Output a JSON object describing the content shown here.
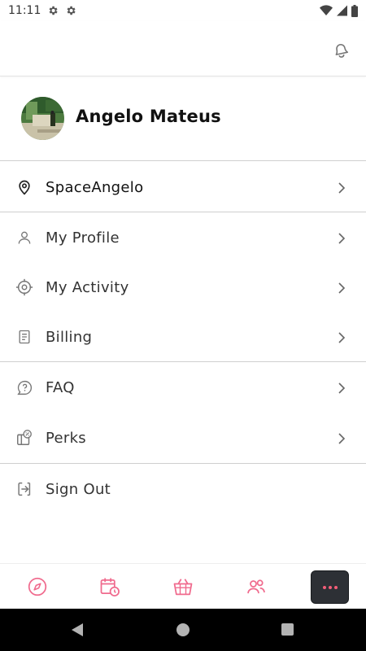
{
  "status_bar": {
    "time": "11:11"
  },
  "profile": {
    "name": "Angelo Mateus"
  },
  "menu": {
    "location": "SpaceAngelo",
    "my_profile": "My Profile",
    "my_activity": "My Activity",
    "billing": "Billing",
    "faq": "FAQ",
    "perks": "Perks",
    "sign_out": "Sign Out"
  },
  "bottom_nav": {
    "items": [
      "compass-icon",
      "calendar-clock-icon",
      "basket-icon",
      "people-icon",
      "more-icon"
    ],
    "active": "more-icon"
  },
  "colors": {
    "accent_pink": "#f06b8e",
    "more_button_bg": "#2d3035",
    "divider": "#cfcfcf",
    "text": "#333333"
  }
}
